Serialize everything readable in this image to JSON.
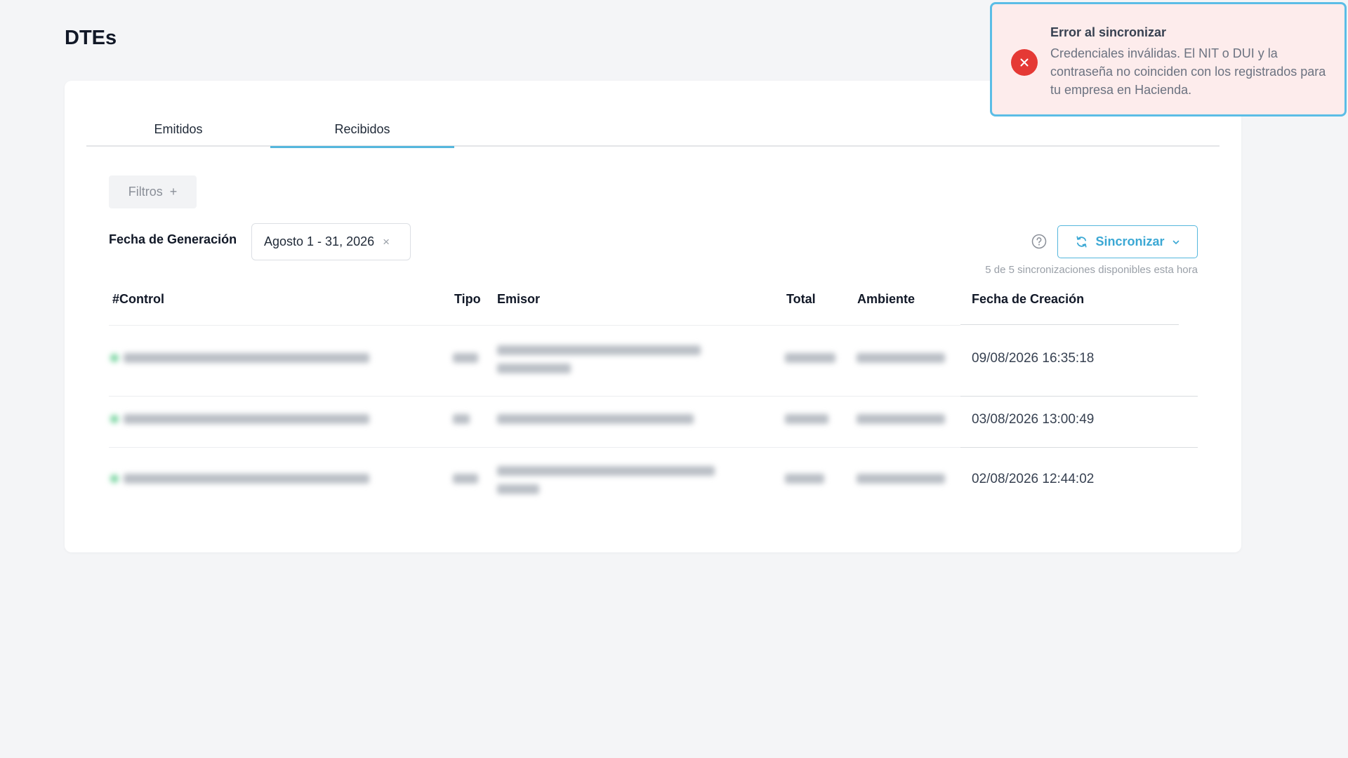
{
  "page": {
    "title": "DTEs"
  },
  "tabs": [
    {
      "label": "Emitidos",
      "active": false
    },
    {
      "label": "Recibidos",
      "active": true
    }
  ],
  "filters": {
    "button_label": "Filtros",
    "plus_icon": "+"
  },
  "date_filter": {
    "label": "Fecha de Generación",
    "value": "Agosto 1 - 31, 2026",
    "clear_icon": "×"
  },
  "sync": {
    "button_label": "Sincronizar",
    "info": "5 de 5 sincronizaciones disponibles esta hora"
  },
  "table": {
    "headers": {
      "control": "#Control",
      "tipo": "Tipo",
      "emisor": "Emisor",
      "total": "Total",
      "ambiente": "Ambiente",
      "fecha": "Fecha de Creación"
    },
    "rows": [
      {
        "fecha": "09/08/2026 16:35:18"
      },
      {
        "fecha": "03/08/2026 13:00:49"
      },
      {
        "fecha": "02/08/2026 12:44:02"
      }
    ]
  },
  "toast": {
    "type": "error",
    "title": "Error al sincronizar",
    "message": "Credenciales inválidas. El NIT o DUI y la contraseña no coinciden con los registrados para tu empresa en Hacienda."
  },
  "colors": {
    "accent": "#55b7dd",
    "error": "#e53935",
    "toast_bg": "#fdecec",
    "status_dot": "#7ed6a4"
  }
}
